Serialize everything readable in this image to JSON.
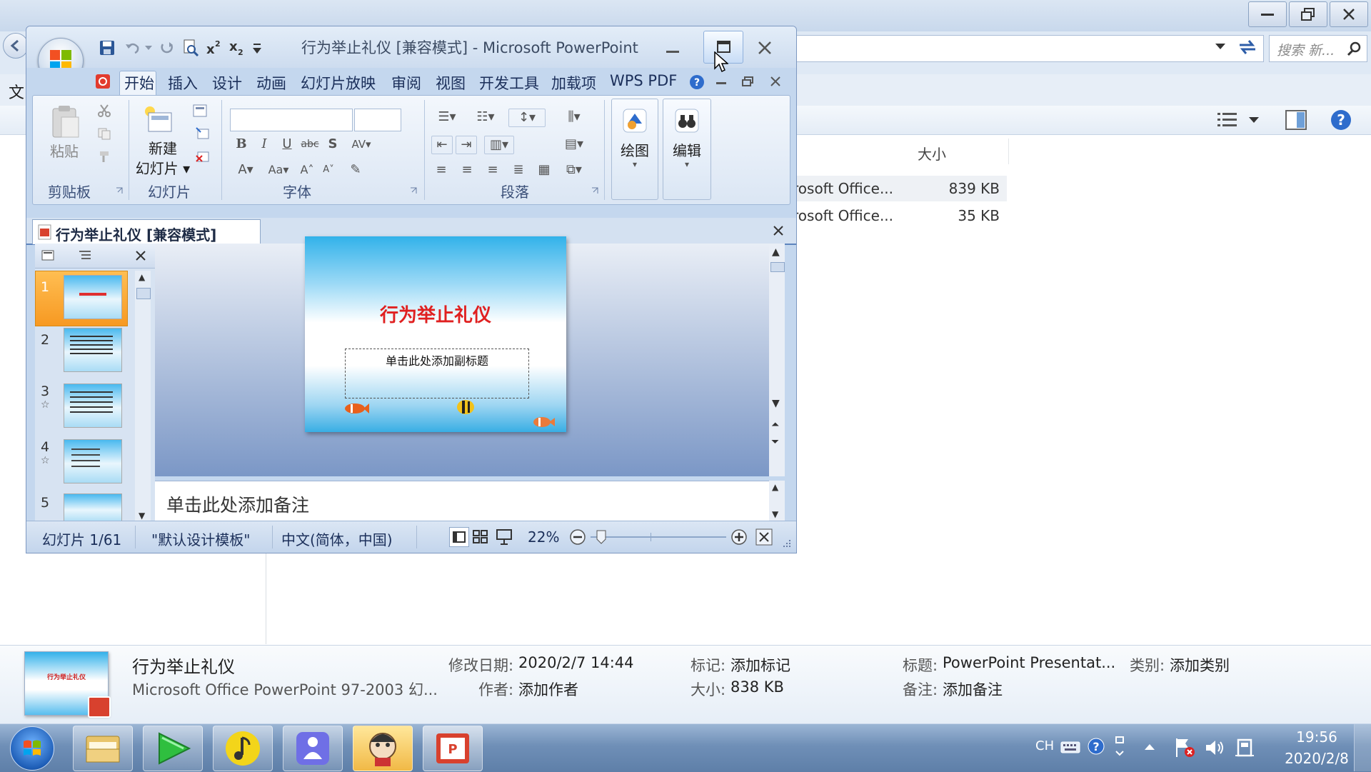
{
  "explorer": {
    "search_placeholder": "搜索 新...",
    "menu_char": "文",
    "col_size": "大小",
    "files": [
      {
        "type": "rosoft Office...",
        "size": "839 KB"
      },
      {
        "type": "rosoft Office...",
        "size": "35 KB"
      }
    ],
    "details": {
      "name": "行为举止礼仪",
      "file_type": "Microsoft Office PowerPoint 97-2003 幻...",
      "modified_label": "修改日期:",
      "modified_value": "2020/2/7 14:44",
      "author_label": "作者:",
      "author_value": "添加作者",
      "tags_label": "标记:",
      "tags_value": "添加标记",
      "size_label": "大小:",
      "size_value": "838 KB",
      "title_label": "标题:",
      "title_value": "PowerPoint Presentat...",
      "category_label": "类别:",
      "category_value": "添加类别",
      "comments_label": "备注:",
      "comments_value": "添加备注",
      "thumb_title": "行为举止礼仪"
    }
  },
  "ppt": {
    "window_title": "行为举止礼仪 [兼容模式] - Microsoft PowerPoint",
    "tabs": [
      "开始",
      "插入",
      "设计",
      "动画",
      "幻灯片放映",
      "审阅",
      "视图",
      "开发工具",
      "加载项",
      "WPS PDF"
    ],
    "groups": {
      "clipboard": "剪贴板",
      "paste": "粘贴",
      "slides": "幻灯片",
      "new_slide_1": "新建",
      "new_slide_2": "幻灯片",
      "font": "字体",
      "paragraph": "段落",
      "drawing": "绘图",
      "editing": "编辑"
    },
    "doc_tab": "行为举止礼仪 [兼容模式]",
    "slide_numbers": [
      "1",
      "2",
      "3",
      "4",
      "5"
    ],
    "slide_title": "行为举止礼仪",
    "slide_subtitle_placeholder": "单击此处添加副标题",
    "notes_placeholder": "单击此处添加备注",
    "status": {
      "slide": "幻灯片 1/61",
      "theme": "\"默认设计模板\"",
      "language": "中文(简体，中国)",
      "zoom": "22%"
    }
  },
  "taskbar": {
    "ime": "CH",
    "time": "19:56",
    "date": "2020/2/8"
  }
}
